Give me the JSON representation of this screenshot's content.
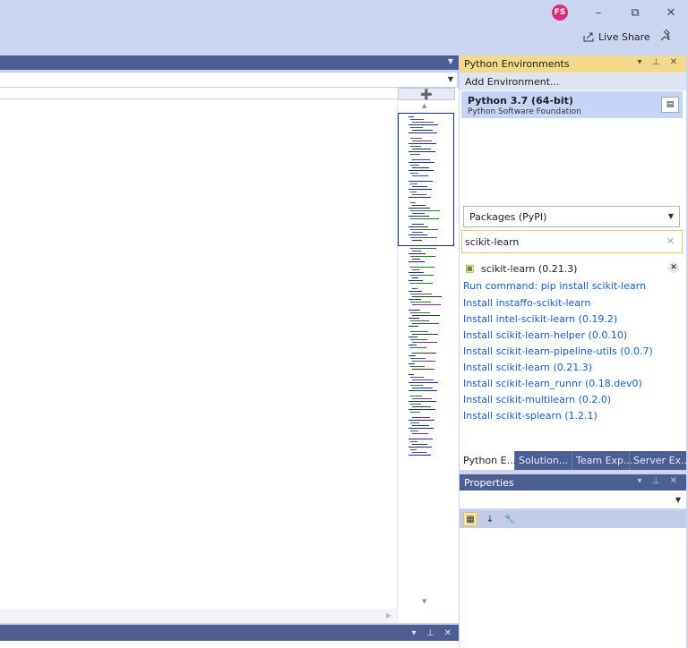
{
  "titlebar": {
    "avatar_initials": "FS",
    "minimize_glyph": "–",
    "restore_glyph": "⧉",
    "close_glyph": "✕",
    "live_share": "Live Share"
  },
  "editor": {
    "split_glyph": "➕"
  },
  "python_envs": {
    "title": "Python Environments",
    "add_environment": "Add Environment...",
    "env_name": "Python 3.7 (64-bit)",
    "env_publisher": "Python Software Foundation",
    "packages_select": "Packages (PyPI)",
    "search_value": "scikit-learn",
    "installed_package": "scikit-learn (0.21.3)",
    "links": [
      "Run command: pip install scikit-learn",
      "Install instaffo-scikit-learn",
      "Install intel-scikit-learn (0.19.2)",
      "Install scikit-learn-helper (0.0.10)",
      "Install scikit-learn-pipeline-utils (0.0.7)",
      "Install scikit-learn (0.21.3)",
      "Install scikit-learn_runnr (0.18.dev0)",
      "Install scikit-multilearn (0.2.0)",
      "Install scikit-splearn (1.2.1)"
    ],
    "link_color": "#1a5cc8"
  },
  "tabs": [
    "Python E...",
    "Solution...",
    "Team Exp...",
    "Server Ex..."
  ],
  "properties": {
    "title": "Properties"
  },
  "colors": {
    "chrome": "#ccd5f0",
    "panel_header": "#4d5e94",
    "active_header": "#f4d98a",
    "selection": "#c6d5f6"
  }
}
